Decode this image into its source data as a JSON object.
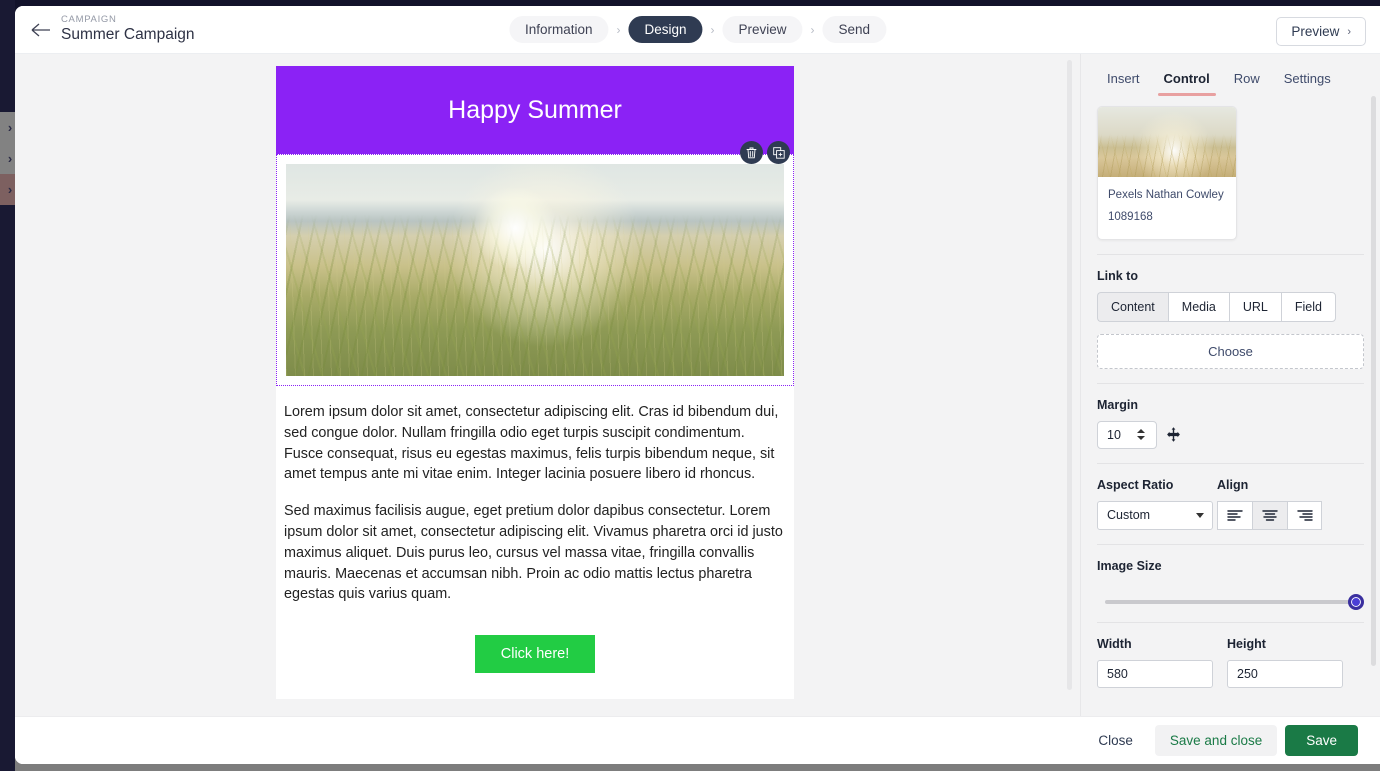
{
  "header": {
    "back_icon": "arrow-left-icon",
    "eyebrow": "CAMPAIGN",
    "title": "Summer Campaign",
    "preview_button": "Preview",
    "preview_chevron": "›",
    "steps": [
      {
        "label": "Information",
        "active": false
      },
      {
        "label": "Design",
        "active": true
      },
      {
        "label": "Preview",
        "active": false
      },
      {
        "label": "Send",
        "active": false
      }
    ],
    "step_separator": "›"
  },
  "left_rail": {
    "items": [
      {
        "icon": "chevron-right-icon",
        "label": "›"
      },
      {
        "icon": "chevron-right-icon",
        "label": "›"
      },
      {
        "icon": "chevron-right-icon",
        "label": "›"
      }
    ]
  },
  "email": {
    "hero_text": "Happy Summer",
    "hero_bg": "#8b22f5",
    "image_alt": "beach grass sunset photo",
    "block_tools": [
      {
        "name": "delete-block-button",
        "icon": "trash-icon"
      },
      {
        "name": "duplicate-block-button",
        "icon": "duplicate-icon"
      }
    ],
    "paragraphs": [
      "Lorem ipsum dolor sit amet, consectetur adipiscing elit. Cras id bibendum dui, sed congue dolor. Nullam fringilla odio eget turpis suscipit condimentum. Fusce consequat, risus eu egestas maximus, felis turpis bibendum neque, sit amet tempus ante mi vitae enim. Integer lacinia posuere libero id rhoncus.",
      "Sed maximus facilisis augue, eget pretium dolor dapibus consectetur. Lorem ipsum dolor sit amet, consectetur adipiscing elit. Vivamus pharetra orci id justo maximus aliquet. Duis purus leo, cursus vel massa vitae, fringilla convallis mauris. Maecenas et accumsan nibh. Proin ac odio mattis lectus pharetra egestas quis varius quam."
    ],
    "cta_label": "Click here!",
    "cta_color": "#22cc44"
  },
  "inspector": {
    "tabs": [
      {
        "label": "Insert",
        "active": false
      },
      {
        "label": "Control",
        "active": true
      },
      {
        "label": "Row",
        "active": false
      },
      {
        "label": "Settings",
        "active": false
      }
    ],
    "active_tab_underline_color": "#e8a0a0",
    "asset": {
      "author": "Pexels Nathan Cowley",
      "id": "1089168"
    },
    "link_to": {
      "label": "Link to",
      "options": [
        {
          "label": "Content",
          "selected": true
        },
        {
          "label": "Media",
          "selected": false
        },
        {
          "label": "URL",
          "selected": false
        },
        {
          "label": "Field",
          "selected": false
        }
      ],
      "choose_label": "Choose"
    },
    "margin": {
      "label": "Margin",
      "value": "10",
      "move_icon": "move-arrows-icon"
    },
    "aspect_ratio": {
      "label": "Aspect Ratio",
      "value": "Custom"
    },
    "align": {
      "label": "Align",
      "options": [
        {
          "name": "align-left",
          "selected": false
        },
        {
          "name": "align-center",
          "selected": true
        },
        {
          "name": "align-right",
          "selected": false
        }
      ]
    },
    "image_size": {
      "label": "Image Size",
      "percent": 100
    },
    "width": {
      "label": "Width",
      "value": "580"
    },
    "height": {
      "label": "Height",
      "value": "250"
    }
  },
  "footer": {
    "close": "Close",
    "save_and_close": "Save and close",
    "save": "Save",
    "save_color": "#1a7a46"
  }
}
